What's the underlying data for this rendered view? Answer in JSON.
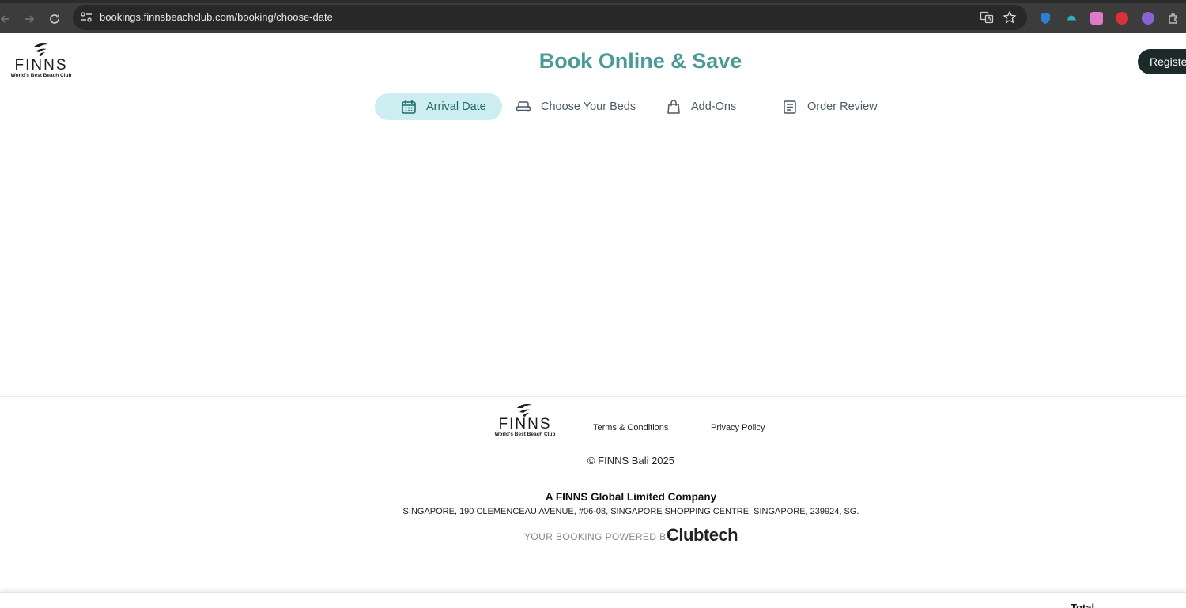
{
  "browser": {
    "url": "bookings.finnsbeachclub.com/booking/choose-date",
    "icons": [
      "back-icon",
      "forward-icon",
      "reload-icon",
      "site-info-icon",
      "translate-icon",
      "star-icon",
      "extension-icon"
    ]
  },
  "header": {
    "logo_word": "FINNS",
    "logo_tagline": "World's Best Beach Club",
    "title": "Book Online & Save",
    "register_label": "Registe"
  },
  "steps": [
    {
      "label": "Arrival Date",
      "icon": "calendar-icon",
      "active": true
    },
    {
      "label": "Choose Your Beds",
      "icon": "sunbed-icon",
      "active": false
    },
    {
      "label": "Add-Ons",
      "icon": "bag-icon",
      "active": false
    },
    {
      "label": "Order Review",
      "icon": "receipt-icon",
      "active": false
    }
  ],
  "footer": {
    "logo_word": "FINNS",
    "logo_tagline": "World's Best Beach Club",
    "terms": "Terms & Conditions",
    "privacy": "Privacy Policy",
    "copyright": "© FINNS Bali 2025",
    "company": "A FINNS Global Limited Company",
    "address": "SINGAPORE, 190 CLEMENCEAU AVENUE, #06-08, SINGAPORE SHOPPING CENTRE, SINGAPORE, 239924, SG.",
    "powered_by": "YOUR BOOKING POWERED BY",
    "powered_brand": "Clubtech"
  },
  "summary_bar": {
    "total_label": "Total"
  },
  "colors": {
    "accent": "#4a9a97",
    "active_step_bg": "#cdeef0",
    "register_bg": "#1c2a2a"
  }
}
